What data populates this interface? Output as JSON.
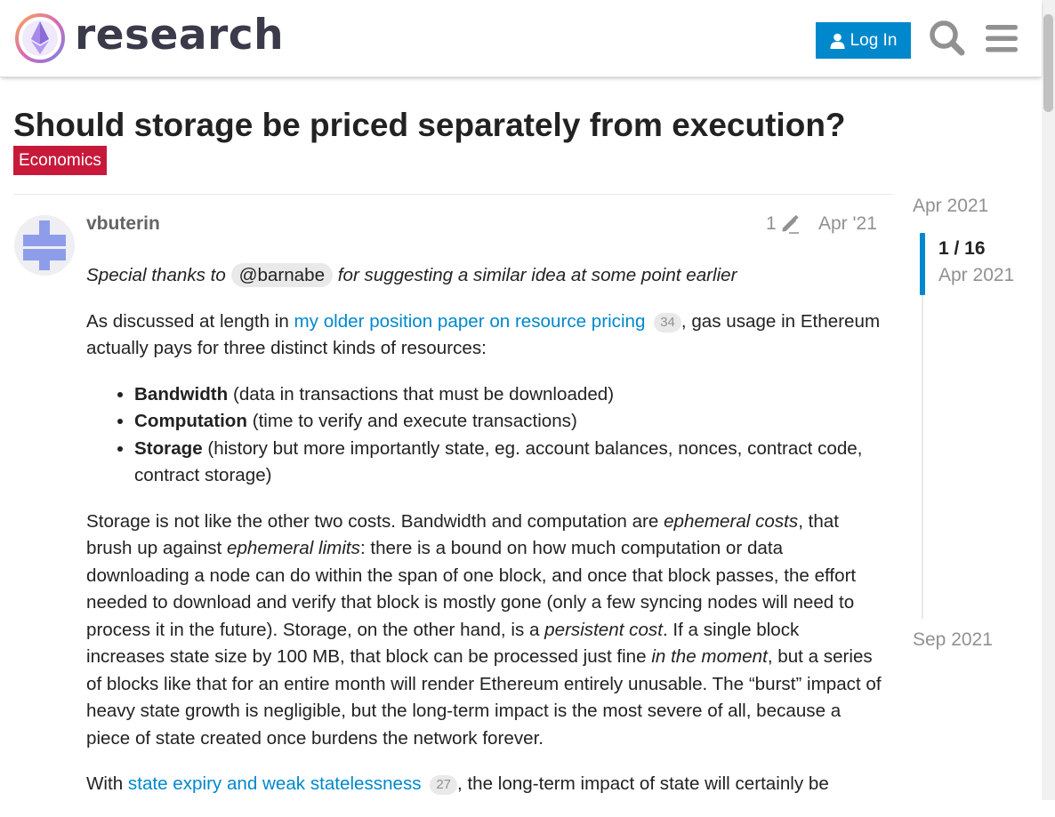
{
  "header": {
    "site_name": "research",
    "login_label": "Log In"
  },
  "topic": {
    "title": "Should storage be priced separately from execution?",
    "category": "Economics",
    "category_color": "#c8193a"
  },
  "post": {
    "username": "vbuterin",
    "edit_count": "1",
    "date": "Apr '21",
    "p1": {
      "pre": "Special thanks to ",
      "mention": "@barnabe",
      "post": " for suggesting a similar idea at some point earlier"
    },
    "p2": {
      "pre": "As discussed at length in ",
      "link": "my older position paper on resource pricing",
      "link_clicks": "34",
      "post": ", gas usage in Ethereum actually pays for three distinct kinds of resources:"
    },
    "list": [
      {
        "term": "Bandwidth",
        "desc": " (data in transactions that must be downloaded)"
      },
      {
        "term": "Computation",
        "desc": " (time to verify and execute transactions)"
      },
      {
        "term": "Storage",
        "desc": " (history but more importantly state, eg. account balances, nonces, contract code, contract storage)"
      }
    ],
    "p3": {
      "a": "Storage is not like the other two costs. Bandwidth and computation are ",
      "b_em": "ephemeral costs",
      "c": ", that brush up against ",
      "d_em": "ephemeral limits",
      "e": ": there is a bound on how much computation or data downloading a node can do within the span of one block, and once that block passes, the effort needed to download and verify that block is mostly gone (only a few syncing nodes will need to process it in the future). Storage, on the other hand, is a ",
      "f_em": "persistent cost",
      "g": ". If a single block increases state size by 100 MB, that block can be processed just fine ",
      "h_em": "in the moment",
      "i": ", but a series of blocks like that for an entire month will render Ethereum entirely unusable. The “burst” impact of heavy state growth is negligible, but the long-term impact is the most severe of all, because a piece of state created once burdens the network forever."
    },
    "p4": {
      "pre": "With ",
      "link": "state expiry and weak statelessness",
      "link_clicks": "27",
      "post": ", the long-term impact of state will certainly be"
    }
  },
  "timeline": {
    "start_date": "Apr 2021",
    "position": "1 / 16",
    "position_fraction": 0.0625,
    "current_date": "Apr 2021",
    "end_date": "Sep 2021"
  },
  "colors": {
    "accent": "#0088cc",
    "badge": "#c8193a",
    "muted": "#919191"
  },
  "icons": [
    "logo-icon",
    "user-icon",
    "search-icon",
    "hamburger-menu-icon",
    "pencil-icon",
    "avatar"
  ]
}
